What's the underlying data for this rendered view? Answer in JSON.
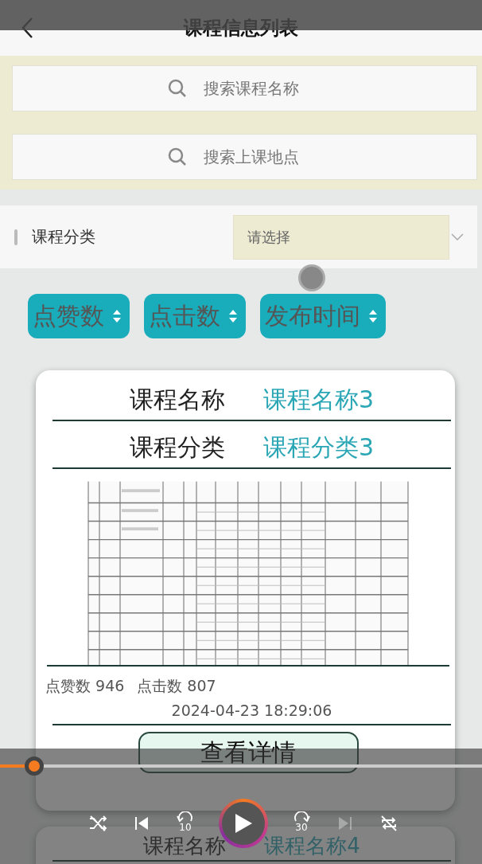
{
  "header": {
    "title": "课程信息列表"
  },
  "search_fields": [
    {
      "placeholder": "搜索课程名称"
    },
    {
      "placeholder": "搜索上课地点"
    }
  ],
  "filter": {
    "label": "课程分类",
    "placeholder": "请选择"
  },
  "sort_buttons": [
    {
      "label": "点赞数"
    },
    {
      "label": "点击数"
    },
    {
      "label": "发布时间"
    }
  ],
  "cards": [
    {
      "fields": [
        {
          "label": "课程名称",
          "value": "课程名称3"
        },
        {
          "label": "课程分类",
          "value": "课程分类3"
        }
      ],
      "image": {
        "kind": "picture"
      },
      "likes_label": "点赞数",
      "likes": "946",
      "clicks_label": "点击数",
      "clicks": "807",
      "date": "2024-04-23 18:29:06",
      "button": "查看详情"
    },
    {
      "fields": [
        {
          "label": "课程名称",
          "value": "课程名称4"
        }
      ]
    }
  ],
  "player": {
    "level": 0.07,
    "controls": [
      {
        "kind": "shuffle",
        "disabled": false
      },
      {
        "kind": "previous",
        "disabled": false
      },
      {
        "kind": "rewind",
        "label": "10",
        "disabled": false
      },
      {
        "kind": "play",
        "disabled": false
      },
      {
        "kind": "forward",
        "label": "30",
        "disabled": false
      },
      {
        "kind": "next",
        "disabled": true
      },
      {
        "kind": "repeat",
        "disabled": false
      }
    ]
  }
}
